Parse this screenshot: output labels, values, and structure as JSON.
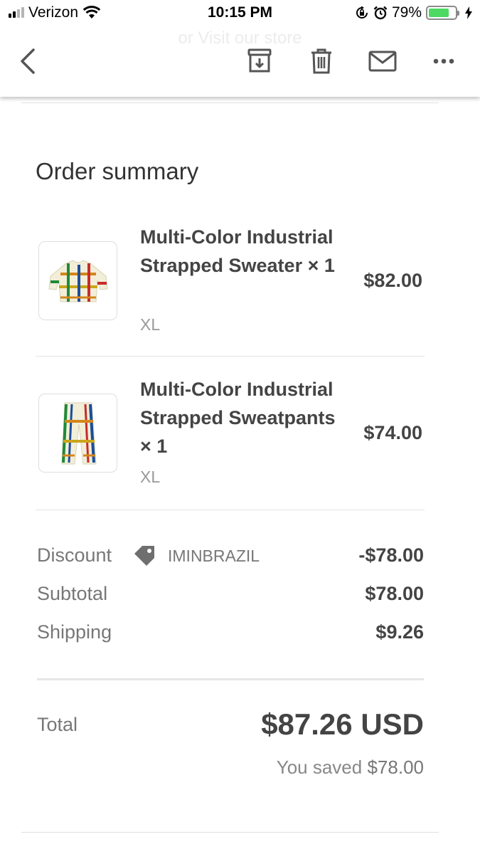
{
  "status_bar": {
    "carrier": "Verizon",
    "time": "10:15 PM",
    "battery_percent": "79%",
    "battery_level": 0.79,
    "battery_color": "#4cd964",
    "icons": [
      "signal-icon",
      "wifi-icon",
      "rotation-lock-icon",
      "alarm-icon",
      "battery-icon",
      "charging-bolt-icon"
    ]
  },
  "toolbar": {
    "ghost_text": "or Visit our store",
    "icons": [
      "back-arrow-icon",
      "archive-icon",
      "trash-icon",
      "mail-icon",
      "more-icon"
    ]
  },
  "order": {
    "title": "Order summary",
    "items": [
      {
        "title": "Multi-Color Industrial Strapped Sweater × 1",
        "variant": "XL",
        "price": "$82.00"
      },
      {
        "title": "Multi-Color Industrial Strapped Sweatpants × 1",
        "variant": "XL",
        "price": "$74.00"
      }
    ],
    "discount": {
      "label": "Discount",
      "code": "IMINBRAZIL",
      "icon": "tag-icon",
      "value": "-$78.00"
    },
    "subtotal": {
      "label": "Subtotal",
      "value": "$78.00"
    },
    "shipping": {
      "label": "Shipping",
      "value": "$9.26"
    },
    "total": {
      "label": "Total",
      "value": "$87.26 USD"
    },
    "saved": {
      "label": "You saved",
      "value": "$78.00"
    }
  }
}
